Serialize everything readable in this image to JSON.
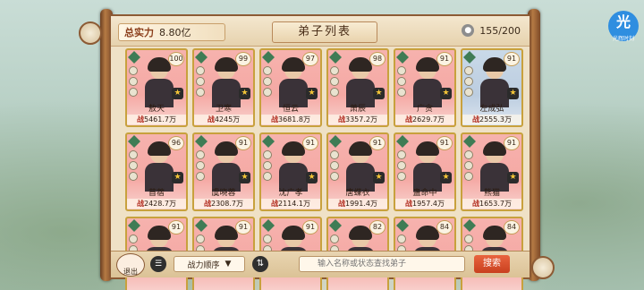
{
  "header": {
    "power_label": "总实力",
    "power_value": "8.80亿",
    "title": "弟子列表",
    "count": "155/200"
  },
  "side_badge": {
    "char": "光",
    "sub": "光辉时刻"
  },
  "cards": [
    {
      "name": "敖天",
      "power": "5461.7万",
      "level": "100",
      "bg": "pink"
    },
    {
      "name": "卫寒",
      "power": "4245万",
      "level": "99",
      "bg": "pink"
    },
    {
      "name": "恒云",
      "power": "3681.8万",
      "level": "97",
      "bg": "pink"
    },
    {
      "name": "萧辰",
      "power": "3357.2万",
      "level": "98",
      "bg": "pink"
    },
    {
      "name": "广贪",
      "power": "2629.7万",
      "level": "91",
      "bg": "pink"
    },
    {
      "name": "左成弘",
      "power": "2555.3万",
      "level": "91",
      "bg": "blue"
    },
    {
      "name": "苜蓿",
      "power": "2428.7万",
      "level": "96",
      "bg": "pink"
    },
    {
      "name": "虞晓蓉",
      "power": "2308.7万",
      "level": "91",
      "bg": "pink"
    },
    {
      "name": "沈广孝",
      "power": "2114.1万",
      "level": "91",
      "bg": "pink"
    },
    {
      "name": "唐蝶衣",
      "power": "1991.4万",
      "level": "91",
      "bg": "pink"
    },
    {
      "name": "蛊命中",
      "power": "1957.4万",
      "level": "91",
      "bg": "pink"
    },
    {
      "name": "熊猫",
      "power": "1653.7万",
      "level": "91",
      "bg": "pink"
    },
    {
      "name": "",
      "power": "",
      "level": "91",
      "bg": "pink"
    },
    {
      "name": "",
      "power": "",
      "level": "91",
      "bg": "pink"
    },
    {
      "name": "",
      "power": "",
      "level": "91",
      "bg": "pink"
    },
    {
      "name": "",
      "power": "",
      "level": "82",
      "bg": "pink"
    },
    {
      "name": "",
      "power": "",
      "level": "84",
      "bg": "pink"
    },
    {
      "name": "",
      "power": "",
      "level": "84",
      "bg": "pink"
    }
  ],
  "power_prefix": "战",
  "bottom": {
    "exit_label": "退出",
    "sort_label": "战力顺序",
    "search_placeholder": "输入名称或状态查找弟子",
    "search_button": "搜索"
  }
}
